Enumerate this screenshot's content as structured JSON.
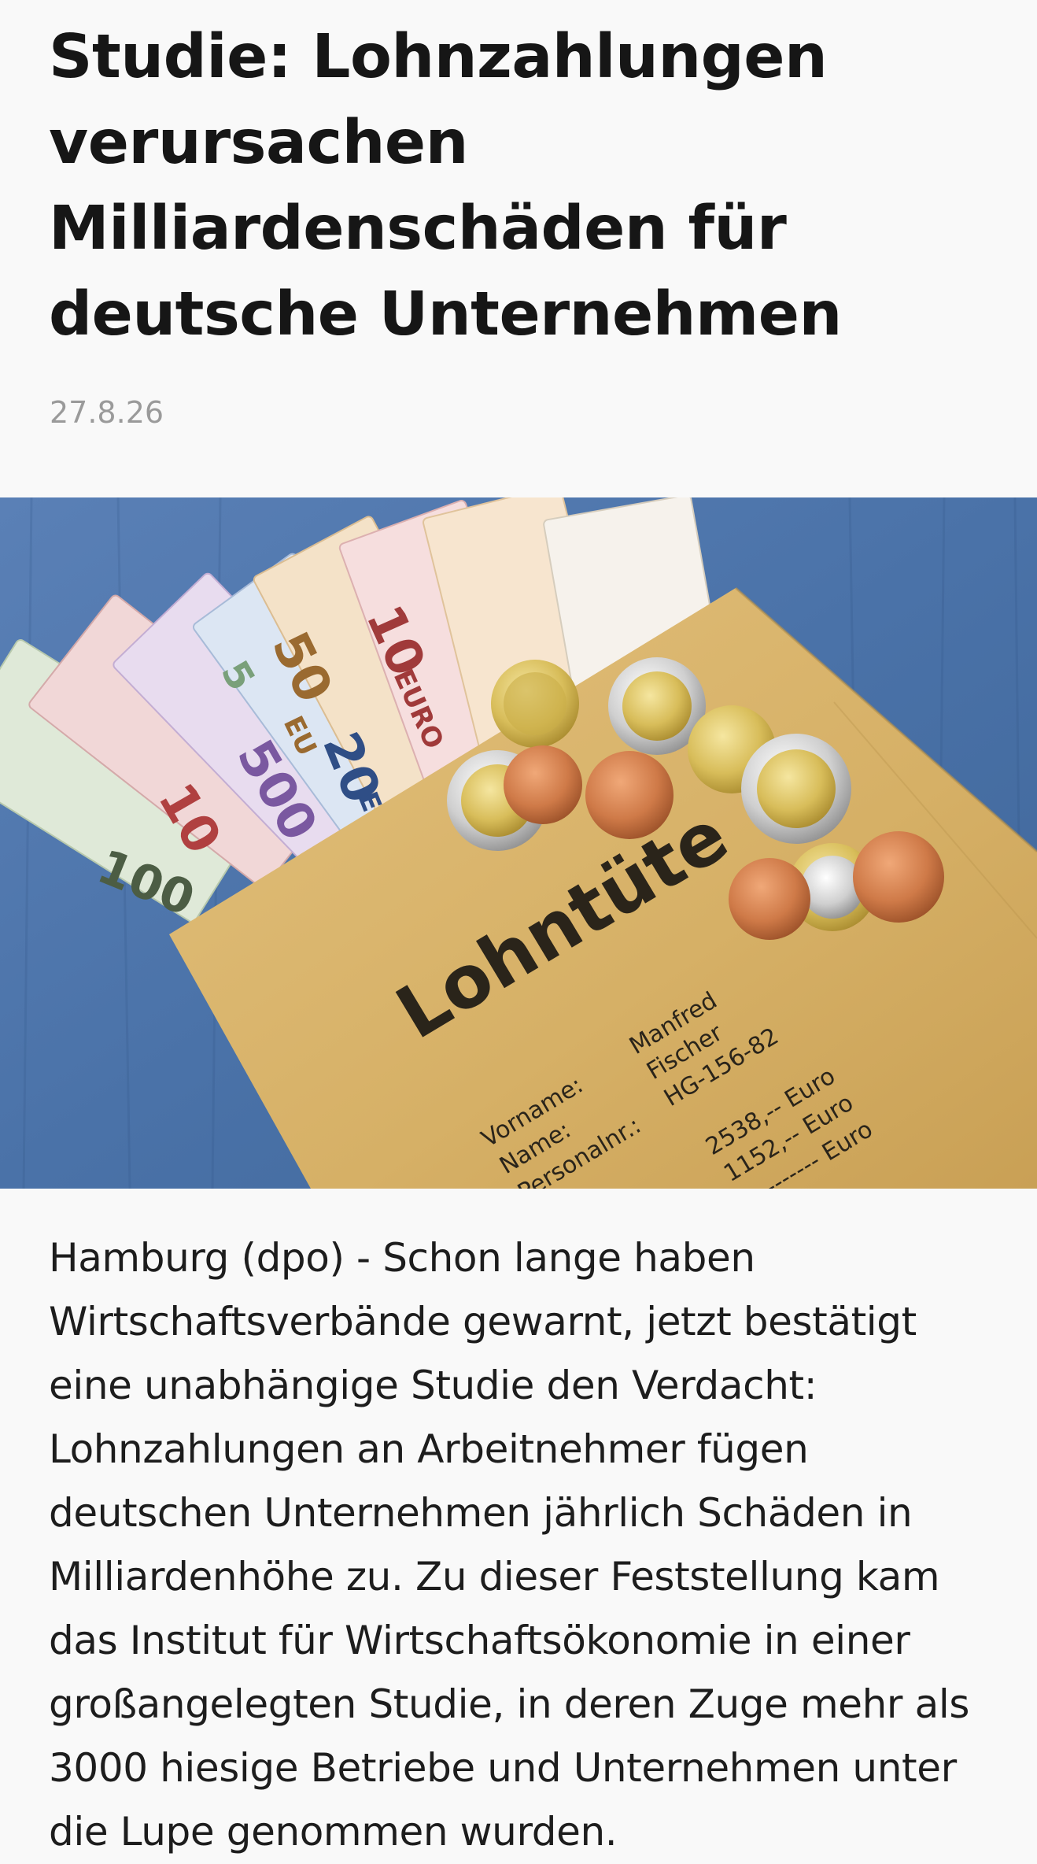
{
  "article": {
    "headline": "Studie: Lohnzahlungen verursachen Milliardenschäden für deutsche Unternehmen",
    "date": "27.8.26",
    "lead": "Hamburg (dpo) - Schon lange haben Wirtschaftsverbände gewarnt, jetzt bestätigt eine unabhängige Studie den Verdacht: Lohnzahlungen an Arbeitnehmer fügen deutschen Unternehmen jährlich Schäden in Milliardenhöhe zu. Zu dieser Feststellung kam das Institut für Wirtschaftsökonomie in einer großangelegten Studie, in deren Zuge mehr als 3000 hiesige Betriebe und Unternehmen unter die Lupe genommen wurden."
  },
  "photo": {
    "envelope_title": "Lohntüte",
    "field_first_name": "Vorname:",
    "field_name": "Name:",
    "field_personnel_no": "Personalnr.:",
    "value_first_name": "Manfred",
    "value_name": "Fischer",
    "value_personnel_no": "HG-156-82",
    "amount_1": "2538,-- Euro",
    "amount_2": "1152,-- Euro",
    "amount_3": "---------- Euro",
    "note_100": "100",
    "note_10a": "10",
    "note_500": "500",
    "note_20": "20",
    "note_50": "50",
    "note_10b": "10",
    "note_euro": "EURO",
    "note_eur": "EUR",
    "note_eu": "EU",
    "note_5": "5"
  },
  "colors": {
    "background": "#f9f9f9",
    "date": "#9a9a9a",
    "table_blue": "#4a72a8",
    "envelope": "#d9b46a"
  }
}
